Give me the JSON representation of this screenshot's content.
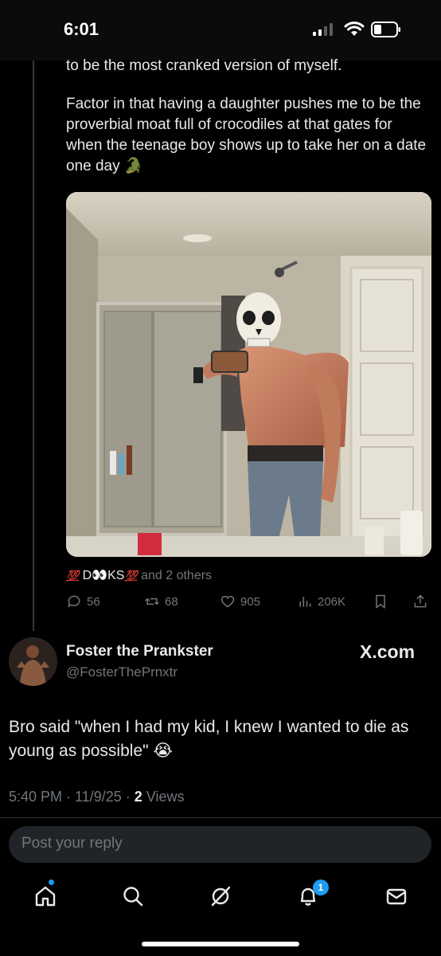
{
  "status_bar": {
    "time": "6:01"
  },
  "quoted_post": {
    "line_1": "to be the most cranked version of myself.",
    "line_2": "Factor in that having a daughter pushes me to be the proverbial moat full of crocodiles at that gates for when the teenage boy shows up to take her on a date one day",
    "emoji": "🐊"
  },
  "likers": {
    "prefix": "💯",
    "name_a": "D",
    "eyes": "👀",
    "name_b": "KS",
    "suffix": "💯",
    "others": " and 2 others"
  },
  "metrics": {
    "replies": "56",
    "reposts": "68",
    "likes": "905",
    "views": "206K"
  },
  "reply": {
    "display_name": "Foster the Prankster",
    "handle": "@FosterThePrnxtr",
    "watermark": "X.com",
    "text": "Bro said \"when I had my kid, I knew I wanted to die as young as possible\"",
    "emoji": "😭",
    "timestamp": "5:40 PM · 11/9/25 · ",
    "views_count": "2",
    "views_label": " Views"
  },
  "composer": {
    "placeholder": "Post your reply"
  },
  "tab_bar": {
    "notification_count": "1"
  },
  "colors": {
    "accent": "#1d9bf0",
    "muted": "#71767b",
    "background": "#000000"
  }
}
